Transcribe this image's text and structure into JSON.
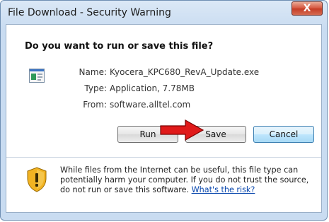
{
  "window": {
    "title": "File Download - Security Warning",
    "close_label": "X"
  },
  "dialog": {
    "question": "Do you want to run or save this file?",
    "fields": [
      {
        "label": "Name:",
        "value": "Kyocera_KPC680_RevA_Update.exe"
      },
      {
        "label": "Type:",
        "value": "Application, 7.78MB"
      },
      {
        "label": "From:",
        "value": "software.alltel.com"
      }
    ],
    "buttons": {
      "run": "Run",
      "save": "Save",
      "cancel": "Cancel"
    },
    "warning": {
      "text": "While files from the Internet can be useful, this file type can potentially harm your computer. If you do not trust the source, do not run or save this software.",
      "link": "What's the risk?"
    }
  },
  "colors": {
    "arrow": "#e01a1a",
    "link": "#0645ad",
    "shield": "#f2b322"
  },
  "icons": {
    "file": "application-file-icon",
    "warning": "warning-shield-icon",
    "pointer": "red-arrow-icon"
  }
}
